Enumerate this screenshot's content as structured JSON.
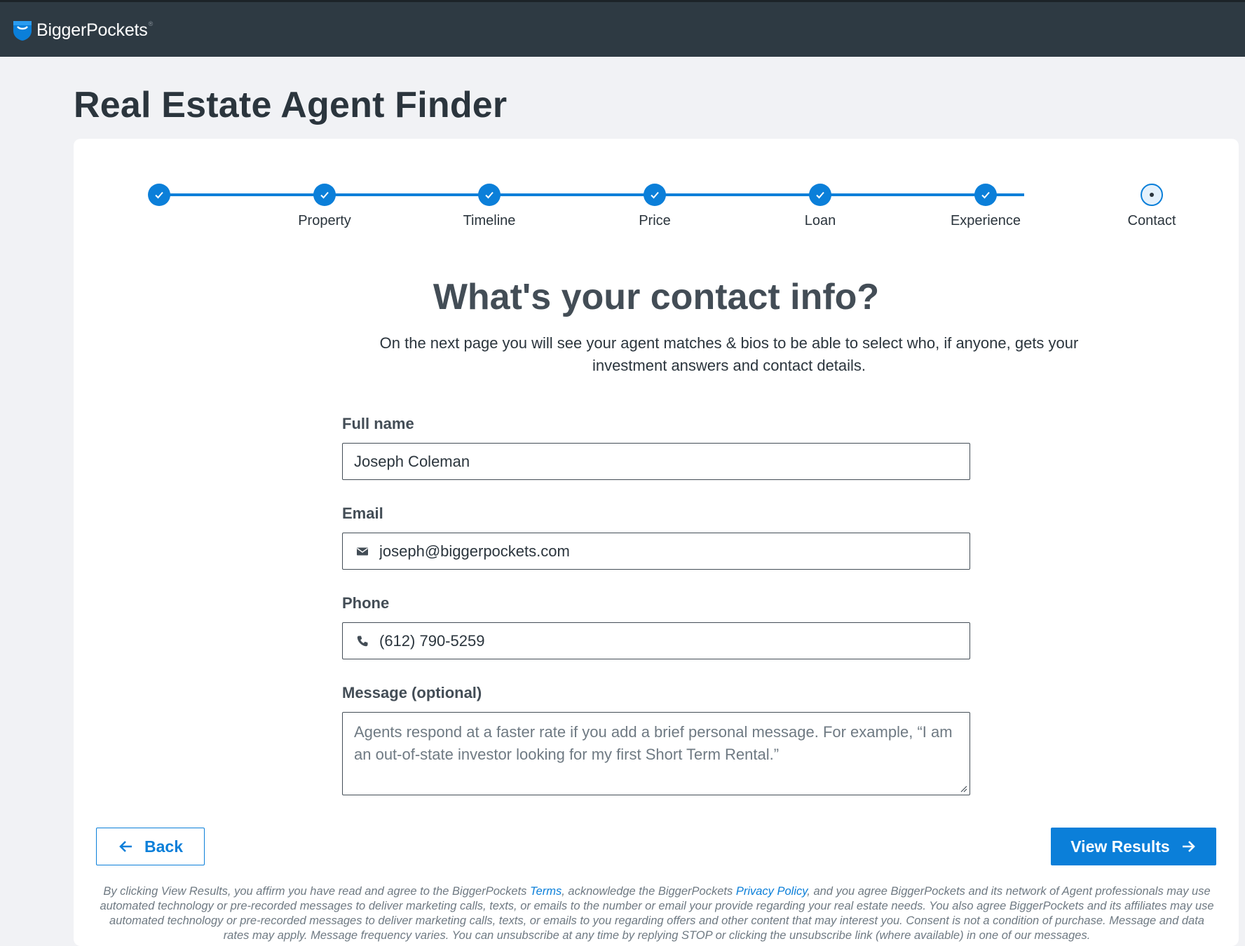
{
  "brand": {
    "name": "BiggerPockets",
    "reg": "®"
  },
  "page": {
    "title": "Real Estate Agent Finder"
  },
  "stepper": {
    "steps": [
      {
        "label": "",
        "status": "complete"
      },
      {
        "label": "Property",
        "status": "complete"
      },
      {
        "label": "Timeline",
        "status": "complete"
      },
      {
        "label": "Price",
        "status": "complete"
      },
      {
        "label": "Loan",
        "status": "complete"
      },
      {
        "label": "Experience",
        "status": "complete"
      },
      {
        "label": "Contact",
        "status": "current"
      }
    ]
  },
  "form": {
    "heading": "What's your contact info?",
    "subtext": "On the next page you will see your agent matches & bios to be able to select who, if anyone, gets your investment answers and contact details.",
    "full_name": {
      "label": "Full name",
      "value": "Joseph Coleman"
    },
    "email": {
      "label": "Email",
      "value": "joseph@biggerpockets.com",
      "icon": "mail-icon"
    },
    "phone": {
      "label": "Phone",
      "value": "(612) 790-5259",
      "icon": "phone-icon"
    },
    "message": {
      "label": "Message (optional)",
      "placeholder": "Agents respond at a faster rate if you add a brief personal message. For example, “I am an out-of-state investor looking for my first Short Term Rental.”"
    }
  },
  "actions": {
    "back_label": "Back",
    "next_label": "View Results"
  },
  "legal": {
    "part1": "By clicking View Results, you affirm you have read and agree to the BiggerPockets ",
    "terms_link": "Terms",
    "part2": ", acknowledge the BiggerPockets ",
    "privacy_link": "Privacy Policy",
    "part3": ", and you agree BiggerPockets and its network of Agent professionals may use automated technology or pre-recorded messages to deliver marketing calls, texts, or emails to the number or email your provide regarding your real estate needs. You also agree BiggerPockets and its affiliates may use automated technology or pre-recorded messages to deliver marketing calls, texts, or emails to you regarding offers and other content that may interest you. Consent is not a condition of purchase. Message and data rates may apply. Message frequency varies. You can unsubscribe at any time by replying STOP or clicking the unsubscribe link (where available) in one of our messages."
  },
  "colors": {
    "accent": "#0b7fd9",
    "topbar": "#2e3a43",
    "page_bg": "#f1f2f5",
    "heading": "#434d56"
  }
}
